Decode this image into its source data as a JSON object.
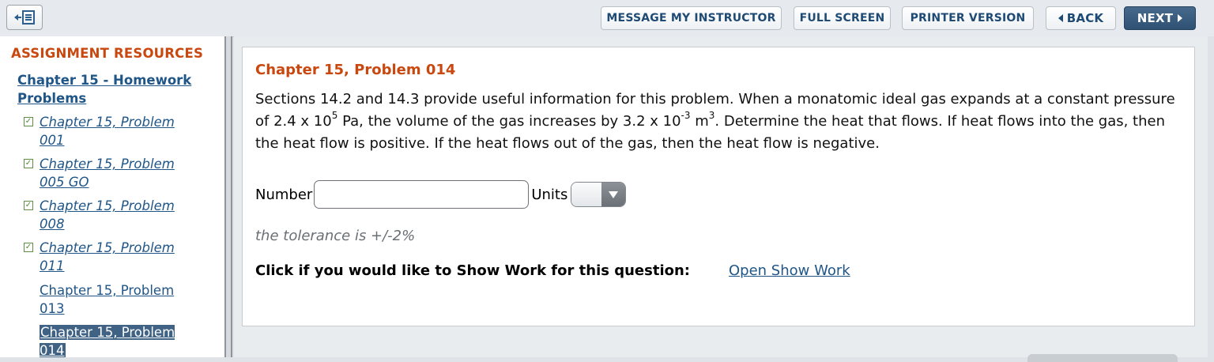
{
  "toolbar": {
    "collapse_icon": "collapse-sidebar-icon",
    "message_label": "MESSAGE MY INSTRUCTOR",
    "fullscreen_label": "FULL SCREEN",
    "printer_label": "PRINTER VERSION",
    "back_label": "BACK",
    "next_label": "NEXT"
  },
  "sidebar": {
    "heading": "ASSIGNMENT RESOURCES",
    "group_link": "Chapter 15 - Homework Problems",
    "items": [
      {
        "label": "Chapter 15, Problem 001",
        "completed": true
      },
      {
        "label": "Chapter 15, Problem 005 GO",
        "completed": true
      },
      {
        "label": "Chapter 15, Problem 008",
        "completed": true
      },
      {
        "label": "Chapter 15, Problem 011",
        "completed": true
      },
      {
        "label": "Chapter 15, Problem 013",
        "completed": false
      },
      {
        "label": "Chapter 15, Problem 014",
        "completed": false,
        "current": true
      }
    ]
  },
  "problem": {
    "title": "Chapter 15, Problem 014",
    "text_part1": "Sections 14.2 and 14.3 provide useful information for this problem. When a monatomic ideal gas expands at a constant pressure of 2.4 x 10",
    "exp1": "5",
    "text_part2": " Pa, the volume of the gas increases by 3.2 x 10",
    "exp2": "-3",
    "text_part3": " m",
    "exp3": "3",
    "text_part4": ". Determine the heat that flows. If heat flows into the gas, then the heat flow is positive. If the heat flows out of the gas, then the heat flow is negative.",
    "number_label": "Number",
    "number_value": "",
    "units_label": "Units",
    "units_selected": "",
    "tolerance": "the tolerance is +/-2%",
    "show_work_prompt": "Click if you would like to Show Work for this question:",
    "show_work_link": "Open Show Work"
  }
}
